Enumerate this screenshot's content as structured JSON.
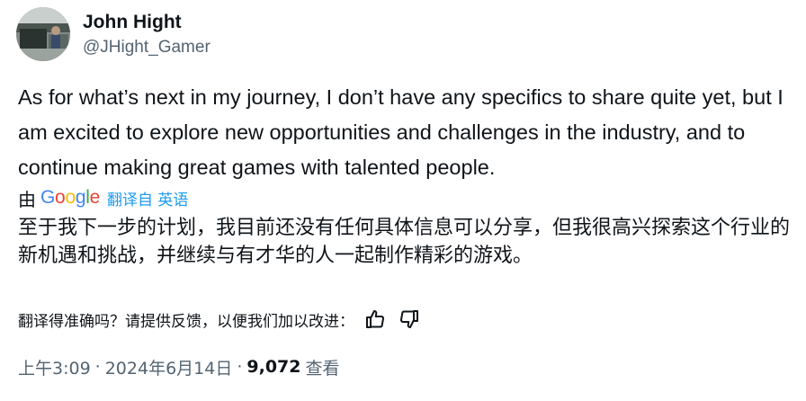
{
  "author": {
    "display_name": "John Hight",
    "handle": "@JHight_Gamer"
  },
  "tweet": {
    "text": "As for what’s next in my journey, I don’t have any specifics to share quite yet, but I am excited to explore new opportunities and challenges in the industry, and to continue making great games with talented people."
  },
  "translation": {
    "by_label": "由",
    "provider_letters": [
      "G",
      "o",
      "o",
      "g",
      "l",
      "e"
    ],
    "translated_from": "翻译自 英语",
    "text": "至于我下一步的计划，我目前还没有任何具体信息可以分享，但我很高兴探索这个行业的新机遇和挑战，并继续与有才华的人一起制作精彩的游戏。",
    "feedback_question": "翻译得准确吗？请提供反馈，以便我们加以改进：",
    "like_icon": "thumbs-up-icon",
    "dislike_icon": "thumbs-down-icon"
  },
  "meta": {
    "time": "上午3:09",
    "separator": "·",
    "date": "2024年6月14日",
    "views_count": "9,072",
    "views_label": "查看"
  },
  "colors": {
    "text": "#0f1419",
    "secondary": "#536471",
    "link": "#1d9bf0",
    "google_blue": "#4285F4",
    "google_red": "#EA4335",
    "google_yellow": "#FBBC05",
    "google_green": "#34A853"
  }
}
